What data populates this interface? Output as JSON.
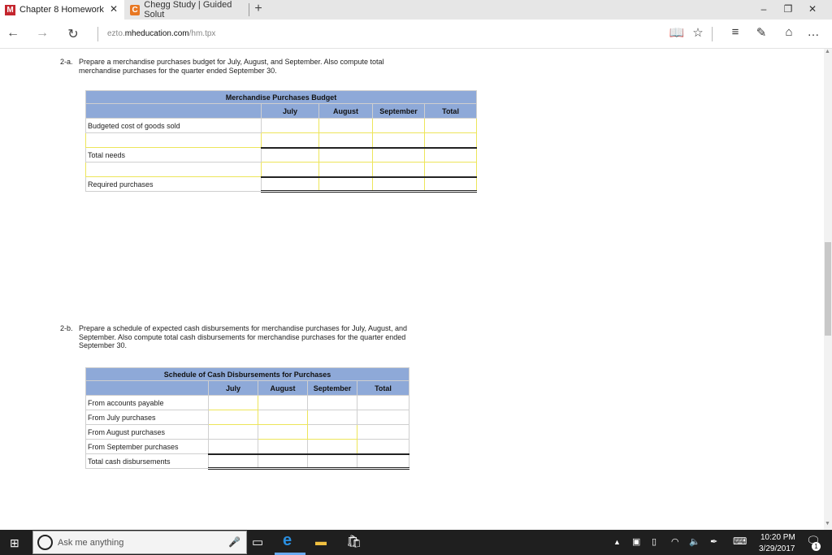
{
  "tabs": [
    {
      "label": "Chapter 8 Homework",
      "favicon": "M",
      "favicon_color": "#c4262e",
      "active": true
    },
    {
      "label": "Chegg Study | Guided Solut",
      "favicon": "C",
      "favicon_color": "#e87722",
      "active": false
    }
  ],
  "address": {
    "prefix": "ezto.",
    "domain": "mheducation.com",
    "path": "/hm.tpx"
  },
  "q2a": {
    "number": "2-a.",
    "text1": "Prepare a merchandise purchases budget for July, August, and September. Also compute total",
    "text2": "merchandise purchases for the quarter ended September 30."
  },
  "budget": {
    "title": "Merchandise Purchases Budget",
    "columns": [
      "July",
      "August",
      "September",
      "Total"
    ],
    "rows": [
      "Budgeted cost of goods sold",
      "",
      "Total needs",
      "",
      "Required purchases"
    ]
  },
  "q2b": {
    "number": "2-b.",
    "text1": "Prepare a schedule of expected cash disbursements for merchandise purchases for July, August, and",
    "text2": "September. Also compute total cash disbursements for merchandise purchases for the quarter ended",
    "text3": "September 30."
  },
  "schedule": {
    "title": "Schedule of Cash Disbursements for Purchases",
    "columns": [
      "July",
      "August",
      "September",
      "Total"
    ],
    "rows": [
      "From accounts payable",
      "From July purchases",
      "From August purchases",
      "From September purchases",
      "Total cash disbursements"
    ]
  },
  "taskbar": {
    "search_placeholder": "Ask me anything",
    "time": "10:20 PM",
    "date": "3/29/2017",
    "notif_count": "1"
  }
}
